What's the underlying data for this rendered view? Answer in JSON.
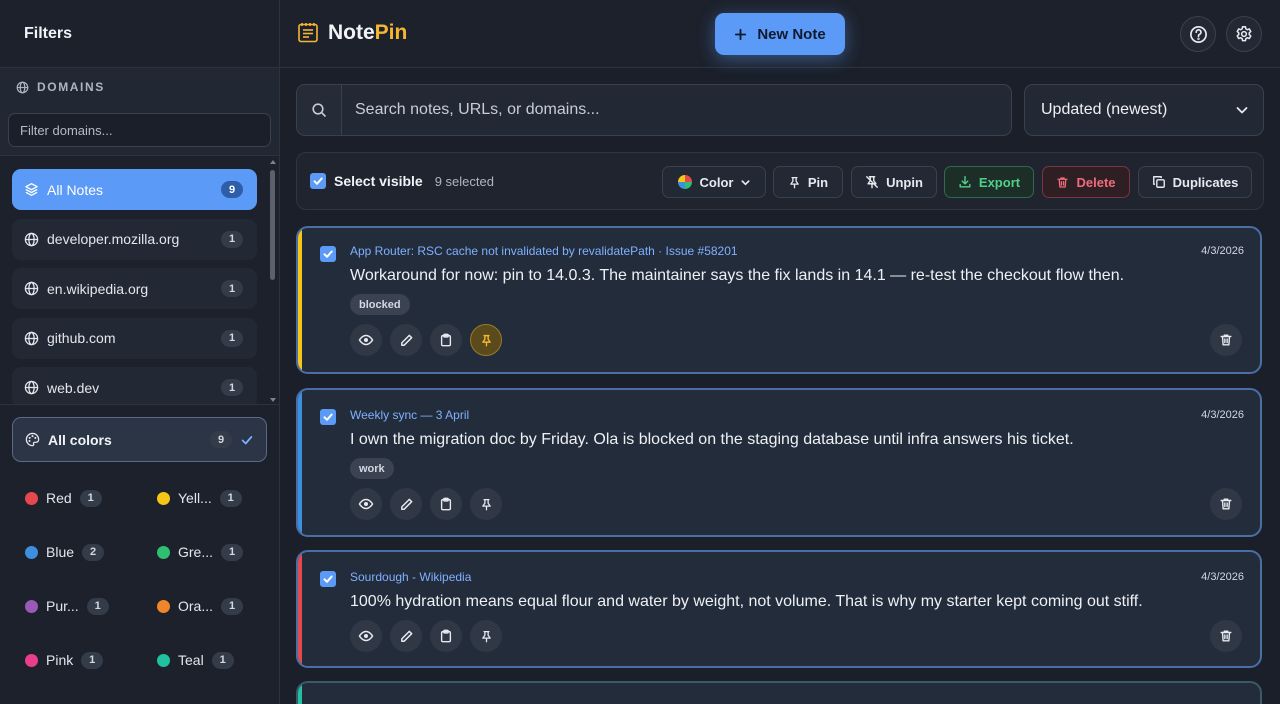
{
  "sidebar": {
    "title": "Filters",
    "domains_title": "DOMAINS",
    "domain_filter_placeholder": "Filter domains...",
    "domains": [
      {
        "label": "All Notes",
        "count": "9",
        "active": true
      },
      {
        "label": "developer.mozilla.org",
        "count": "1"
      },
      {
        "label": "en.wikipedia.org",
        "count": "1"
      },
      {
        "label": "github.com",
        "count": "1"
      },
      {
        "label": "web.dev",
        "count": "1"
      }
    ],
    "all_colors": {
      "label": "All colors",
      "count": "9"
    },
    "colors": [
      {
        "label": "Red",
        "count": "1",
        "hex": "#e5484d"
      },
      {
        "label": "Yell...",
        "count": "1",
        "hex": "#f5c518"
      },
      {
        "label": "Blue",
        "count": "2",
        "hex": "#3d8fe0"
      },
      {
        "label": "Gre...",
        "count": "1",
        "hex": "#2fbf71"
      },
      {
        "label": "Pur...",
        "count": "1",
        "hex": "#9b59b6"
      },
      {
        "label": "Ora...",
        "count": "1",
        "hex": "#f0862a"
      },
      {
        "label": "Pink",
        "count": "1",
        "hex": "#e83e8c"
      },
      {
        "label": "Teal",
        "count": "1",
        "hex": "#20c0a0"
      }
    ]
  },
  "header": {
    "brand_note": "Note",
    "brand_pin": "Pin",
    "new_note_label": "New Note",
    "accent": "#5b9af7"
  },
  "search": {
    "placeholder": "Search notes, URLs, or domains..."
  },
  "sort": {
    "selected": "Updated (newest)"
  },
  "bulk": {
    "select_visible": "Select visible",
    "selected_count": "9 selected",
    "color": "Color",
    "pin": "Pin",
    "unpin": "Unpin",
    "export": "Export",
    "delete": "Delete",
    "duplicates": "Duplicates"
  },
  "notes": [
    {
      "source": "App Router: RSC cache not invalidated by revalidatePath · Issue #58201",
      "date": "4/3/2026",
      "body": "Workaround for now: pin to 14.0.3. The maintainer says the fix lands in 14.1 — re-test the checkout flow then.",
      "tag": "blocked",
      "color": "#f5c518",
      "pinned": true
    },
    {
      "source": "Weekly sync — 3 April",
      "date": "4/3/2026",
      "body": "I own the migration doc by Friday. Ola is blocked on the staging database until infra answers his ticket.",
      "tag": "work",
      "color": "#3d8fe0",
      "pinned": false
    },
    {
      "source": "Sourdough - Wikipedia",
      "date": "4/3/2026",
      "body": "100% hydration means equal flour and water by weight, not volume. That is why my starter kept coming out stiff.",
      "tag": "",
      "color": "#e5484d",
      "pinned": false
    }
  ]
}
